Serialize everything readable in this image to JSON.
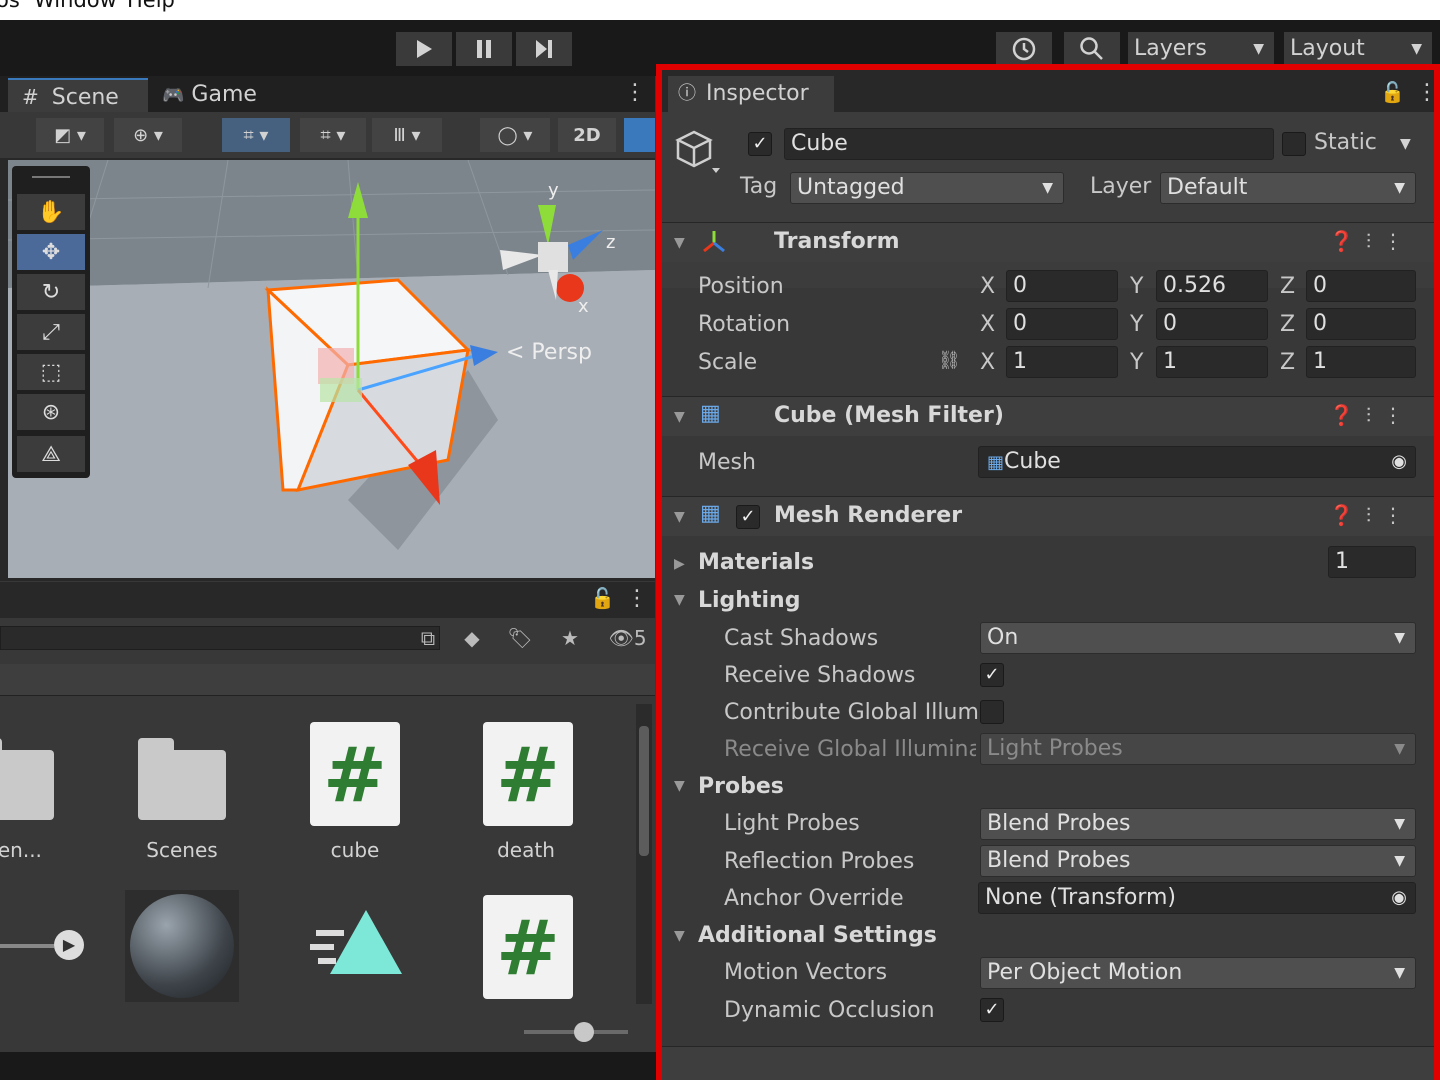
{
  "menu": {
    "items": [
      "os",
      "Window",
      "Help"
    ]
  },
  "toolbar": {
    "layers_label": "Layers",
    "layout_label": "Layout"
  },
  "scene": {
    "tabs": [
      {
        "label": "Scene"
      },
      {
        "label": "Game"
      }
    ],
    "twod_label": "2D",
    "persp_label": "< Persp",
    "gizmo": {
      "y": "y",
      "z": "z",
      "x": "x"
    }
  },
  "project": {
    "hidden_count": "5",
    "assets": [
      {
        "label": "Adven..."
      },
      {
        "label": "Scenes"
      },
      {
        "label": "cube"
      },
      {
        "label": "death"
      }
    ]
  },
  "inspector": {
    "tab_label": "Inspector",
    "object_name": "Cube",
    "static_label": "Static",
    "tag_label": "Tag",
    "tag_value": "Untagged",
    "layer_label": "Layer",
    "layer_value": "Default",
    "transform": {
      "title": "Transform",
      "position_label": "Position",
      "rotation_label": "Rotation",
      "scale_label": "Scale",
      "axis_x": "X",
      "axis_y": "Y",
      "axis_z": "Z",
      "position": {
        "x": "0",
        "y": "0.526",
        "z": "0"
      },
      "rotation": {
        "x": "0",
        "y": "0",
        "z": "0"
      },
      "scale": {
        "x": "1",
        "y": "1",
        "z": "1"
      }
    },
    "mesh_filter": {
      "title": "Cube (Mesh Filter)",
      "mesh_label": "Mesh",
      "mesh_value": "Cube"
    },
    "mesh_renderer": {
      "title": "Mesh Renderer",
      "materials_label": "Materials",
      "materials_count": "1",
      "lighting_label": "Lighting",
      "cast_shadows_label": "Cast Shadows",
      "cast_shadows_value": "On",
      "receive_shadows_label": "Receive Shadows",
      "contribute_gi_label": "Contribute Global Illumin",
      "receive_gi_label": "Receive Global Illuminati",
      "receive_gi_value": "Light Probes",
      "probes_label": "Probes",
      "light_probes_label": "Light Probes",
      "light_probes_value": "Blend Probes",
      "reflection_probes_label": "Reflection Probes",
      "reflection_probes_value": "Blend Probes",
      "anchor_override_label": "Anchor Override",
      "anchor_override_value": "None (Transform)",
      "additional_label": "Additional Settings",
      "motion_vectors_label": "Motion Vectors",
      "motion_vectors_value": "Per Object Motion",
      "dynamic_occlusion_label": "Dynamic Occlusion"
    }
  },
  "colors": {
    "highlight_border": "#e00000",
    "accent": "#3a79bb",
    "script_green": "#2f7d32"
  },
  "icons": [
    "play-icon",
    "pause-icon",
    "step-icon",
    "history-icon",
    "search-icon",
    "hash-icon",
    "gamepad-icon",
    "hand-icon",
    "move-icon",
    "rotate-icon",
    "scale-icon",
    "rect-icon",
    "transform-icon",
    "custom-icon",
    "lock-icon",
    "kebab-icon",
    "cube-icon",
    "help-icon",
    "preset-icon",
    "mesh-grid-icon",
    "target-icon",
    "link-icon",
    "folder-icon",
    "script-icon",
    "sphere-icon",
    "audio-icon"
  ]
}
